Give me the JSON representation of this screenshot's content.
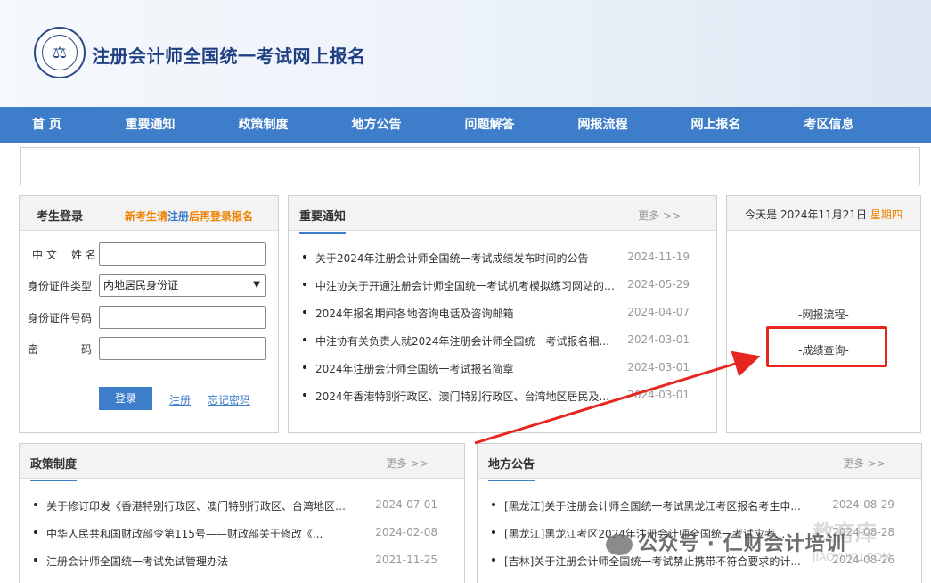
{
  "header": {
    "title": "注册会计师全国统一考试网上报名"
  },
  "nav": {
    "items": [
      "首 页",
      "重要通知",
      "政策制度",
      "地方公告",
      "问题解答",
      "网报流程",
      "网上报名",
      "考区信息"
    ]
  },
  "login": {
    "title": "考生登录",
    "tip_before": "新考生请",
    "tip_link": "注册",
    "tip_after": "后再登录报名",
    "name_label_a": "中 文",
    "name_label_b": "姓 名",
    "id_type_label": "身份证件类型",
    "id_type_value": "内地居民身份证",
    "id_number_label": "身份证件号码",
    "password_label_a": "密",
    "password_label_b": "码",
    "login_button": "登录",
    "register_link": "注册",
    "forgot_link": "忘记密码"
  },
  "notices": {
    "title": "重要通知",
    "more": "更多 >>",
    "items": [
      {
        "text": "关于2024年注册会计师全国统一考试成绩发布时间的公告",
        "date": "2024-11-19"
      },
      {
        "text": "中注协关于开通注册会计师全国统一考试机考模拟练习网站的公...",
        "date": "2024-05-29"
      },
      {
        "text": "2024年报名期间各地咨询电话及咨询邮箱",
        "date": "2024-04-07"
      },
      {
        "text": "中注协有关负责人就2024年注册会计师全国统一考试报名相...",
        "date": "2024-03-01"
      },
      {
        "text": "2024年注册会计师全国统一考试报名简章",
        "date": "2024-03-01"
      },
      {
        "text": "2024年香港特别行政区、澳门特别行政区、台湾地区居民及...",
        "date": "2024-03-01"
      }
    ]
  },
  "sidebar": {
    "today_prefix": "今天是 2024年11月21日",
    "weekday": "星期四",
    "links": [
      "-网报流程-",
      "-成绩查询-"
    ]
  },
  "policy": {
    "title": "政策制度",
    "more": "更多 >>",
    "items": [
      {
        "text": "关于修订印发《香港特别行政区、澳门特别行政区、台湾地区居...",
        "date": "2024-07-01"
      },
      {
        "text": "中华人民共和国财政部令第115号——财政部关于修改《...",
        "date": "2024-02-08"
      },
      {
        "text": "注册会计师全国统一考试免试管理办法",
        "date": "2021-11-25"
      }
    ]
  },
  "local": {
    "title": "地方公告",
    "more": "更多 >>",
    "items": [
      {
        "text": "[黑龙江]关于注册会计师全国统一考试黑龙江考区报名考生申...",
        "date": "2024-08-29"
      },
      {
        "text": "[黑龙江]黑龙江考区2024年注册会计师全国统一考试应考...",
        "date": "2024-08-28"
      },
      {
        "text": "[吉林]关于注册会计师全国统一考试禁止携带不符合要求的计...",
        "date": "2024-08-26"
      }
    ]
  },
  "watermark": {
    "text": "公众号 · 仁财会计培训",
    "faint": "教育库",
    "faint_url": "JIAOYUKU.COM"
  },
  "colors": {
    "nav_bg": "#3d7dca",
    "accent_orange": "#f08200",
    "highlight_red": "#e6261f",
    "title_blue": "#1f3f82"
  }
}
